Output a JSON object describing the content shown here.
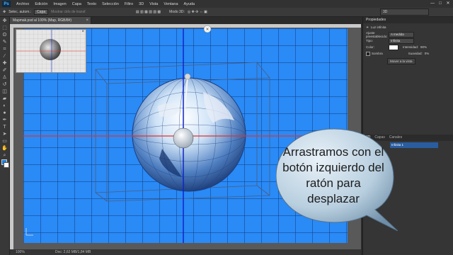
{
  "app": {
    "logo": "Ps",
    "menu": [
      "Archivo",
      "Edición",
      "Imagen",
      "Capa",
      "Texto",
      "Selección",
      "Filtro",
      "3D",
      "Vista",
      "Ventana",
      "Ayuda"
    ],
    "window_controls": [
      "—",
      "□",
      "✕"
    ]
  },
  "options_bar": {
    "select_label": "Selec. autom.:",
    "select_value": "Capa",
    "hint": "Mostrar ctrls de transf.",
    "mode_label": "Modo 3D:",
    "workspace": "3D"
  },
  "document": {
    "tab_title": "Mapmak.psd al 100% (Map, RGB/8#)",
    "tab_close": "×",
    "zoom": "100%",
    "doc_info": "Doc: 2,62 MB/1,84 MB"
  },
  "properties_panel": {
    "header": "Propiedades",
    "title": "Luz infinita",
    "preset_label": "Ajuste preestablecido:",
    "preset_value": "A medida",
    "type_label": "Tipo:",
    "type_value": "Infinita",
    "color_label": "Color:",
    "intensity_label": "Intensidad:",
    "intensity_value": "90%",
    "shadow_label": "Sombra",
    "softness_label": "Suavidad:",
    "softness_value": "0%",
    "move_btn": "Mover a la vista"
  },
  "layers_panel": {
    "tabs": [
      "3D",
      "Capas",
      "Canales"
    ],
    "item": "Infinita 1"
  },
  "callout": {
    "text": "Arrastramos con el botón izquierdo del ratón para desplazar"
  },
  "colors": {
    "canvas_blue": "#2a8af6",
    "guide_red": "#e8322a",
    "guide_blue": "#1024c8"
  }
}
